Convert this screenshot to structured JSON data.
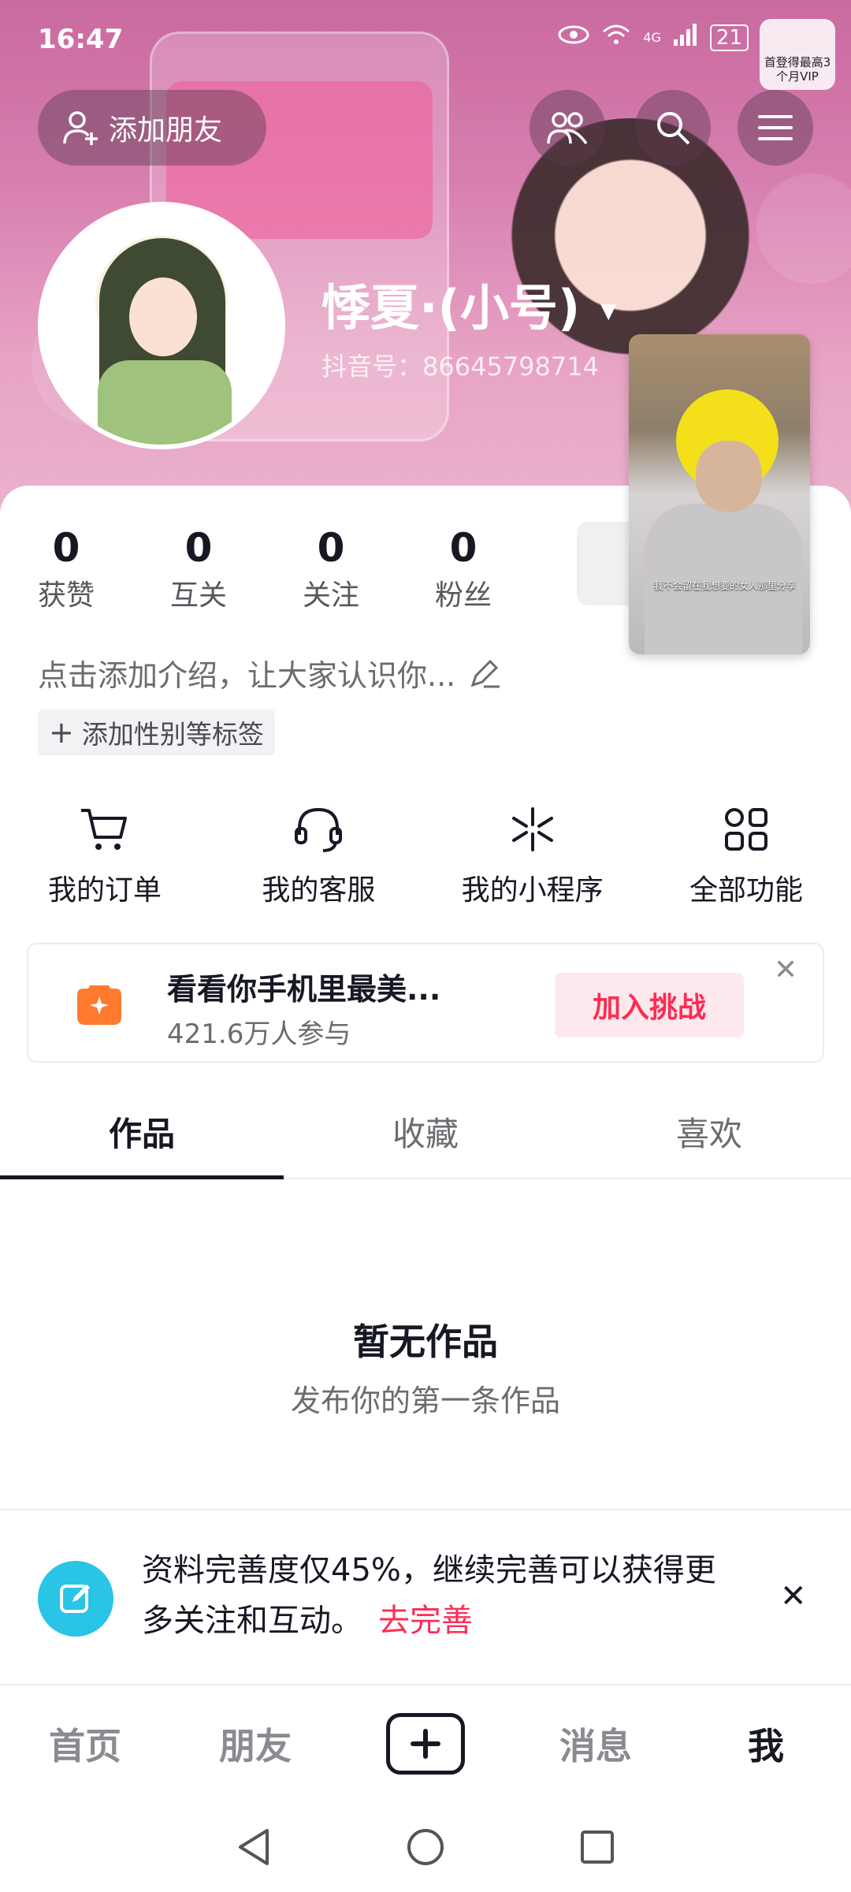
{
  "status_bar": {
    "time": "16:47",
    "network": "4G",
    "battery": "21",
    "vip_badge": "首登得最高3个月VIP"
  },
  "header": {
    "add_friend_label": "添加朋友",
    "nickname": "悸夏·(小号)",
    "douyin_id": "抖音号：86645798714"
  },
  "stats": [
    {
      "value": "0",
      "label": "获赞"
    },
    {
      "value": "0",
      "label": "互关"
    },
    {
      "value": "0",
      "label": "关注"
    },
    {
      "value": "0",
      "label": "粉丝"
    }
  ],
  "bio": {
    "placeholder": "点击添加介绍，让大家认识你..."
  },
  "tag_button": {
    "label": "添加性别等标签"
  },
  "quick_actions": [
    {
      "label": "我的订单",
      "icon": "cart-icon"
    },
    {
      "label": "我的客服",
      "icon": "headset-icon"
    },
    {
      "label": "我的小程序",
      "icon": "mini-program-icon"
    },
    {
      "label": "全部功能",
      "icon": "grid-icon"
    }
  ],
  "promo": {
    "title": "看看你手机里最美...",
    "subtitle": "421.6万人参与",
    "button": "加入挑战"
  },
  "floating_video": {
    "caption": "我不会留在我想要的女人那里分享"
  },
  "tabs": [
    {
      "label": "作品"
    },
    {
      "label": "收藏"
    },
    {
      "label": "喜欢"
    }
  ],
  "empty_state": {
    "title": "暂无作品",
    "subtitle": "发布你的第一条作品"
  },
  "completion_tip": {
    "text": "资料完善度仅45%，继续完善可以获得更多关注和互动。",
    "link": "去完善",
    "percent": 45
  },
  "bottom_nav": [
    {
      "label": "首页"
    },
    {
      "label": "朋友"
    },
    {
      "label": "消息"
    },
    {
      "label": "我"
    }
  ],
  "colors": {
    "accent": "#fe2c55",
    "banner": "#d77eb0",
    "edit_icon_bg": "#29c4e6",
    "promo_icon": "#ff7a2f"
  }
}
